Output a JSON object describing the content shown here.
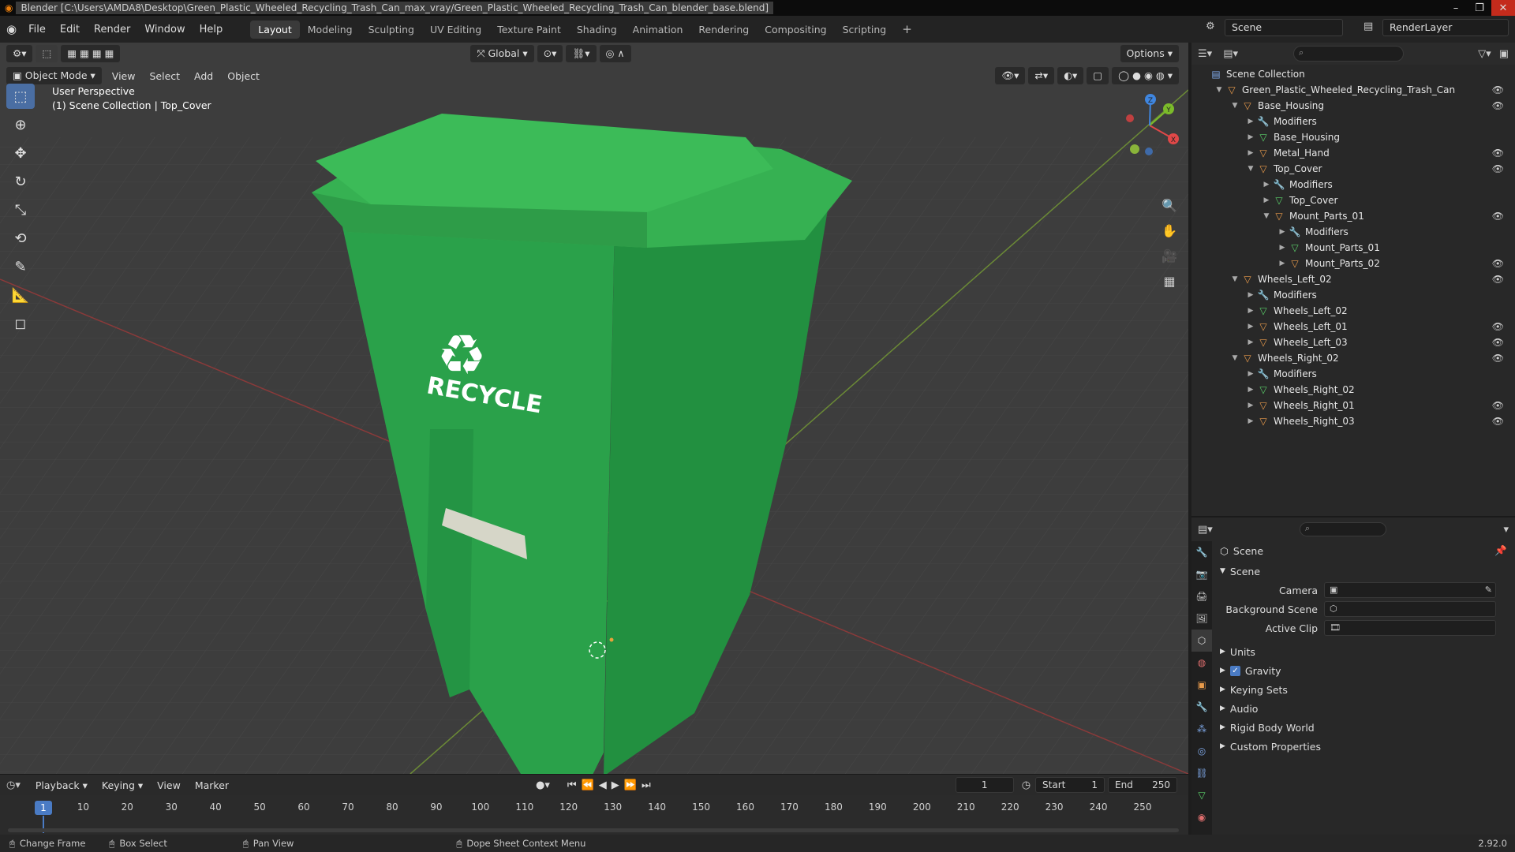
{
  "window": {
    "title": "Blender [C:\\Users\\AMDA8\\Desktop\\Green_Plastic_Wheeled_Recycling_Trash_Can_max_vray/Green_Plastic_Wheeled_Recycling_Trash_Can_blender_base.blend]"
  },
  "menu": [
    "File",
    "Edit",
    "Render",
    "Window",
    "Help"
  ],
  "workspaces": [
    "Layout",
    "Modeling",
    "Sculpting",
    "UV Editing",
    "Texture Paint",
    "Shading",
    "Animation",
    "Rendering",
    "Compositing",
    "Scripting"
  ],
  "active_workspace": "Layout",
  "scene_name": "Scene",
  "render_layer": "RenderLayer",
  "viewport": {
    "transform_orientation": "Global",
    "options_label": "Options",
    "mode": "Object Mode",
    "menus": [
      "View",
      "Select",
      "Add",
      "Object"
    ],
    "overlay_line1": "User Perspective",
    "overlay_line2": "(1) Scene Collection | Top_Cover",
    "can_label": "RECYCLE",
    "axis_x": "X",
    "axis_y": "Y",
    "axis_z": "Z"
  },
  "outliner": {
    "rows": [
      {
        "label": "Scene Collection",
        "icon": "collection",
        "depth": 0,
        "tri": "",
        "eye": false
      },
      {
        "label": "Green_Plastic_Wheeled_Recycling_Trash_Can",
        "icon": "object",
        "depth": 1,
        "tri": "down",
        "eye": true
      },
      {
        "label": "Base_Housing",
        "icon": "object",
        "depth": 2,
        "tri": "down",
        "eye": true
      },
      {
        "label": "Modifiers",
        "icon": "modifier",
        "depth": 3,
        "tri": "right",
        "eye": false
      },
      {
        "label": "Base_Housing",
        "icon": "mesh",
        "depth": 3,
        "tri": "right",
        "eye": false
      },
      {
        "label": "Metal_Hand",
        "icon": "object",
        "depth": 3,
        "tri": "right",
        "eye": true
      },
      {
        "label": "Top_Cover",
        "icon": "object",
        "depth": 3,
        "tri": "down",
        "eye": true
      },
      {
        "label": "Modifiers",
        "icon": "modifier",
        "depth": 4,
        "tri": "right",
        "eye": false
      },
      {
        "label": "Top_Cover",
        "icon": "mesh",
        "depth": 4,
        "tri": "right",
        "eye": false
      },
      {
        "label": "Mount_Parts_01",
        "icon": "object",
        "depth": 4,
        "tri": "down",
        "eye": true
      },
      {
        "label": "Modifiers",
        "icon": "modifier",
        "depth": 5,
        "tri": "right",
        "eye": false
      },
      {
        "label": "Mount_Parts_01",
        "icon": "mesh",
        "depth": 5,
        "tri": "right",
        "eye": false
      },
      {
        "label": "Mount_Parts_02",
        "icon": "object",
        "depth": 5,
        "tri": "right",
        "eye": true
      },
      {
        "label": "Wheels_Left_02",
        "icon": "object",
        "depth": 2,
        "tri": "down",
        "eye": true
      },
      {
        "label": "Modifiers",
        "icon": "modifier",
        "depth": 3,
        "tri": "right",
        "eye": false
      },
      {
        "label": "Wheels_Left_02",
        "icon": "mesh",
        "depth": 3,
        "tri": "right",
        "eye": false
      },
      {
        "label": "Wheels_Left_01",
        "icon": "object",
        "depth": 3,
        "tri": "right",
        "eye": true
      },
      {
        "label": "Wheels_Left_03",
        "icon": "object",
        "depth": 3,
        "tri": "right",
        "eye": true
      },
      {
        "label": "Wheels_Right_02",
        "icon": "object",
        "depth": 2,
        "tri": "down",
        "eye": true
      },
      {
        "label": "Modifiers",
        "icon": "modifier",
        "depth": 3,
        "tri": "right",
        "eye": false
      },
      {
        "label": "Wheels_Right_02",
        "icon": "mesh",
        "depth": 3,
        "tri": "right",
        "eye": false
      },
      {
        "label": "Wheels_Right_01",
        "icon": "object",
        "depth": 3,
        "tri": "right",
        "eye": true
      },
      {
        "label": "Wheels_Right_03",
        "icon": "object",
        "depth": 3,
        "tri": "right",
        "eye": true
      }
    ]
  },
  "properties": {
    "header": "Scene",
    "section": "Scene",
    "camera_label": "Camera",
    "background_scene_label": "Background Scene",
    "active_clip_label": "Active Clip",
    "panels": [
      "Units",
      "Gravity",
      "Keying Sets",
      "Audio",
      "Rigid Body World",
      "Custom Properties"
    ],
    "gravity_checked": true
  },
  "timeline": {
    "menus": [
      "Playback",
      "Keying",
      "View",
      "Marker"
    ],
    "current_frame": "1",
    "start_label": "Start",
    "start": "1",
    "end_label": "End",
    "end": "250",
    "ruler": [
      "10",
      "20",
      "30",
      "40",
      "50",
      "60",
      "70",
      "80",
      "90",
      "100",
      "110",
      "120",
      "130",
      "140",
      "150",
      "160",
      "170",
      "180",
      "190",
      "200",
      "210",
      "220",
      "230",
      "240",
      "250"
    ]
  },
  "statusbar": {
    "change_frame": "Change Frame",
    "box_select": "Box Select",
    "pan_view": "Pan View",
    "context_menu": "Dope Sheet Context Menu",
    "version": "2.92.0"
  },
  "colors": {
    "accent": "#4a7bc4",
    "can_green": "#2fa84b",
    "object_orange": "#e99b4b"
  }
}
